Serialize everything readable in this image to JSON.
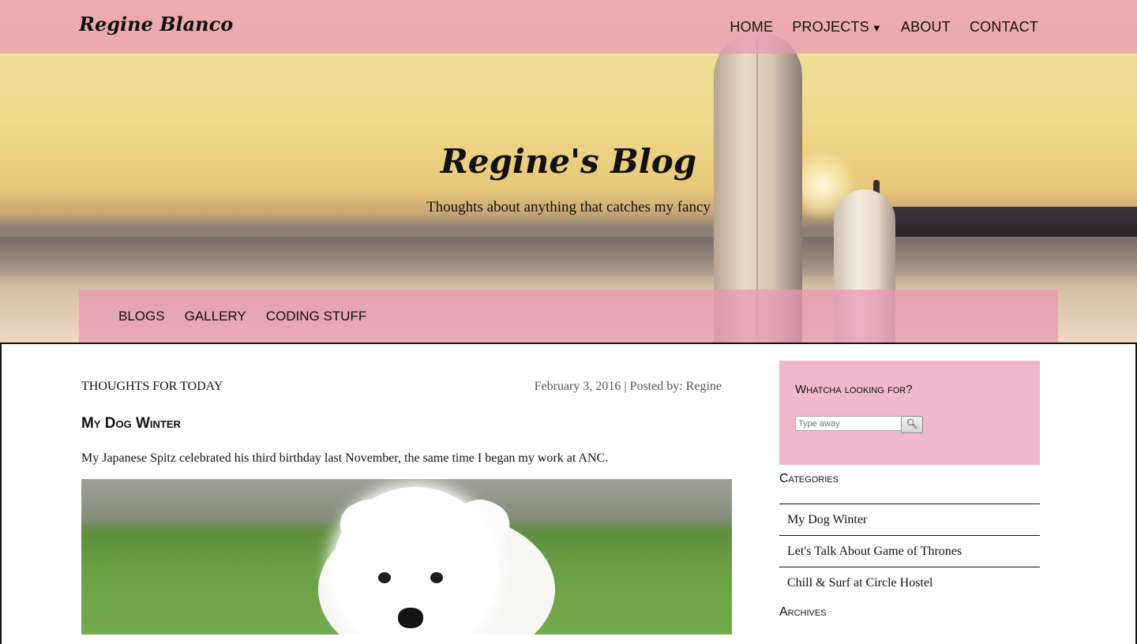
{
  "brand": "Regine Blanco",
  "top_nav": {
    "home": "HOME",
    "projects": "PROJECTS",
    "about": "ABOUT",
    "contact": "CONTACT"
  },
  "hero": {
    "title": "Regine's Blog",
    "subtitle": "Thoughts about anything that catches my fancy"
  },
  "sub_nav": {
    "blogs": "BLOGS",
    "gallery": "GALLERY",
    "coding": "CODING STUFF"
  },
  "post": {
    "category": "THOUGHTS FOR TODAY",
    "meta": "February 3, 2016 | Posted by: Regine",
    "title": "My Dog Winter",
    "text": "My Japanese Spitz celebrated his third birthday last November, the same time I began my work at ANC."
  },
  "sidebar": {
    "search_heading": "Whatcha looking for?",
    "search_placeholder": "Type away",
    "categories_heading": "Categories",
    "categories": [
      "My Dog Winter",
      "Let's Talk About Game of Thrones",
      "Chill & Surf at Circle Hostel"
    ],
    "archives_heading": "Archives"
  },
  "colors": {
    "accent_pink": "#f1b8cd",
    "nav_pink": "#e996b6"
  }
}
